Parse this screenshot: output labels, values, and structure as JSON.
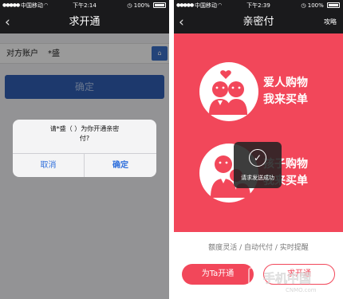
{
  "left": {
    "status": {
      "carrier": "中国移动",
      "time": "下午2:14",
      "battery": "100%"
    },
    "nav": {
      "title": "求开通"
    },
    "field": {
      "label": "对方账户",
      "value": "*盛"
    },
    "confirm_label": "确定",
    "alert": {
      "message_line1": "请*盛（                    ）为你开通亲密",
      "message_line2": "付?",
      "cancel": "取消",
      "ok": "确定"
    }
  },
  "right": {
    "status": {
      "carrier": "中国移动",
      "time": "下午2:39",
      "battery": "100%"
    },
    "nav": {
      "title": "亲密付",
      "right_link": "攻略"
    },
    "features": [
      {
        "line1": "爱人购物",
        "line2": "我来买单"
      },
      {
        "line1": "孩子购物",
        "line2": "我来买单"
      }
    ],
    "toast": "请求发送成功",
    "tagline": "额度灵活 / 自动代付 / 实时提醒",
    "pay_button": "为Ta开通",
    "ask_button": "求开通"
  },
  "colors": {
    "accent": "#f2475a",
    "blue": "#2f5db0",
    "ios_blue": "#2f6fdc"
  },
  "watermark": {
    "line1": "手机中国",
    "line2": "CNMO.com"
  }
}
